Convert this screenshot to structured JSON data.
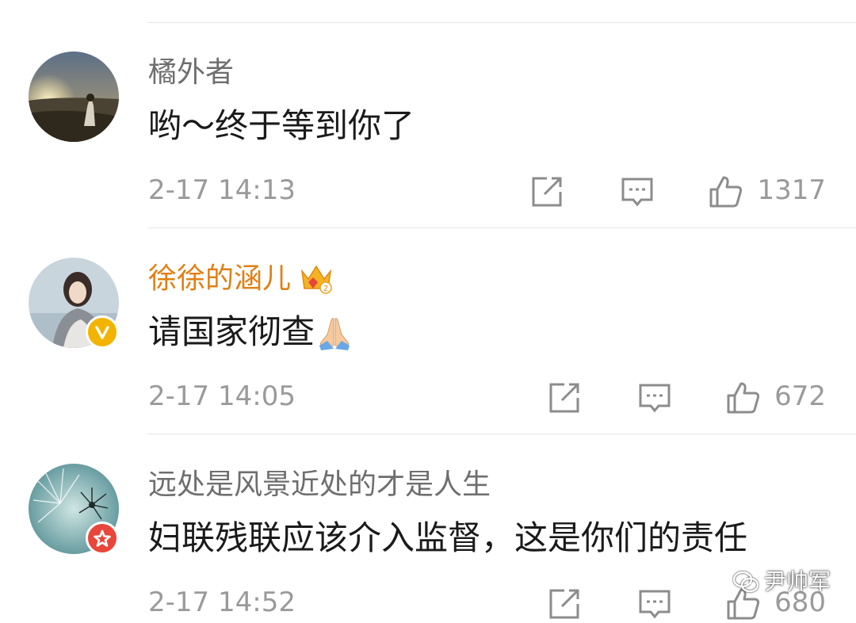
{
  "comments": [
    {
      "username": "橘外者",
      "content": "哟～终于等到你了",
      "time": "2-17 14:13",
      "likes": "1317",
      "share_icon": "share-icon",
      "reply_icon": "comment-icon",
      "like_icon": "thumbs-up-icon"
    },
    {
      "username": "徐徐的涵儿",
      "content": "请国家彻查",
      "time": "2-17 14:05",
      "likes": "672",
      "vip_crown": "crown-icon",
      "emoji": "praying-hands-emoji",
      "badge": "verified-gold-badge"
    },
    {
      "username": "远处是风景近处的才是人生",
      "content": "妇联残联应该介入监督，这是你们的责任",
      "time": "2-17 14:52",
      "likes": "680",
      "badge": "verified-red-badge"
    }
  ],
  "watermark": {
    "text": "尹帅军",
    "icon": "wechat-icon"
  },
  "colors": {
    "vip_username": "#e27f13",
    "username": "#6e6e6e",
    "meta": "#9a9a9a",
    "badge_gold": "#f2b400",
    "badge_red": "#e8463a"
  }
}
